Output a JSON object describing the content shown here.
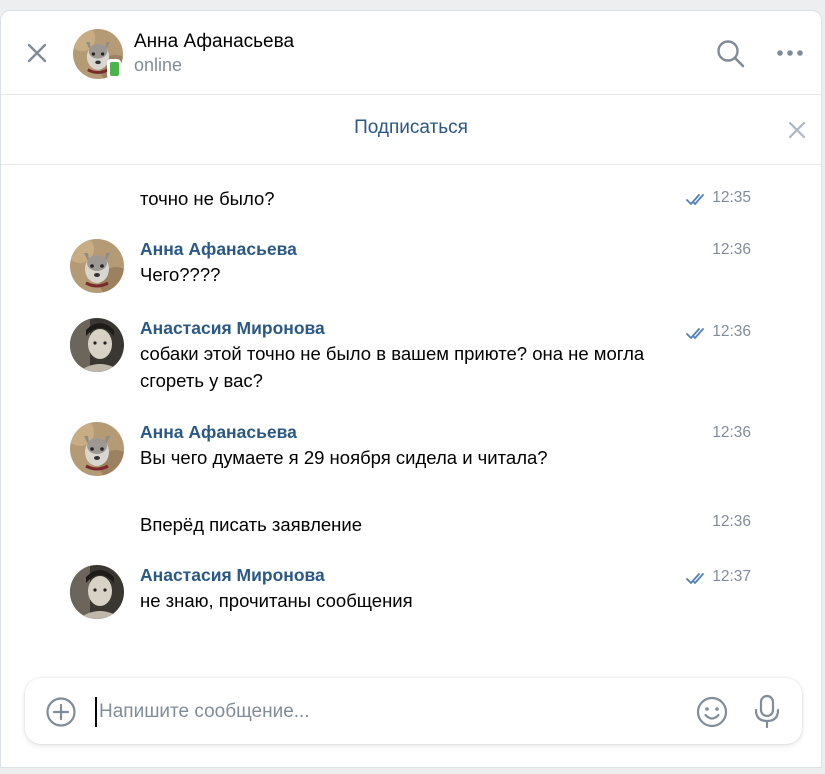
{
  "header": {
    "peer_name": "Анна Афанасьева",
    "peer_status": "online"
  },
  "subscribe": {
    "label": "Подписаться"
  },
  "messages": [
    {
      "author": "",
      "text": "точно не было?",
      "time": "12:35",
      "read": true
    },
    {
      "author": "Анна Афанасьева",
      "text": "Чего????",
      "time": "12:36",
      "read": false
    },
    {
      "author": "Анастасия Миронова",
      "text": "собаки этой точно не было в вашем приюте? она не могла сгореть у вас?",
      "time": "12:36",
      "read": true
    },
    {
      "author": "Анна Афанасьева",
      "text": "Вы чего думаете я 29 ноября сидела и читала?",
      "time": "12:36",
      "read": false
    },
    {
      "author": "",
      "text": "Вперёд писать заявление",
      "time": "12:36",
      "read": false
    },
    {
      "author": "Анастасия Миронова",
      "text": "не знаю, прочитаны сообщения",
      "time": "12:37",
      "read": true
    }
  ],
  "composer": {
    "placeholder": "Напишите сообщение..."
  },
  "colors": {
    "link": "#2a5885",
    "secondary": "#818c99",
    "online": "#4bb34b",
    "read_check": "#5181b8"
  }
}
